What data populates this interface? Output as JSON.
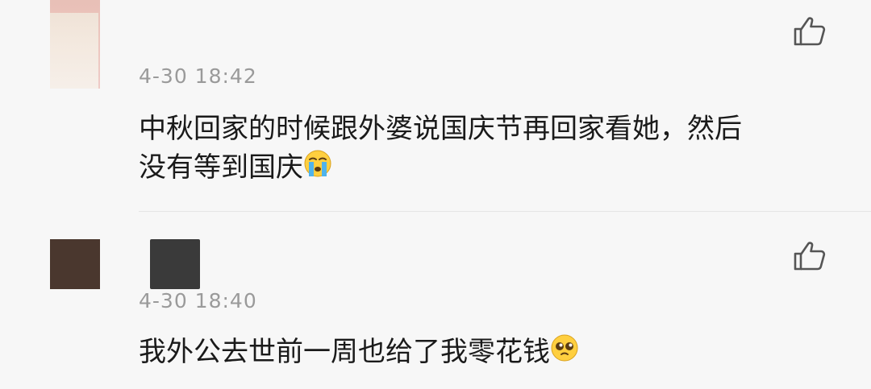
{
  "comments": [
    {
      "timestamp": "4-30 18:42",
      "text_line_1": "中秋回家的时候跟外婆说国庆节再回家看她，然后",
      "text_line_2": "没有等到国庆",
      "emoji": "crying-face",
      "like_icon": "thumbs-up-outline"
    },
    {
      "timestamp": "4-30 18:40",
      "text_line_1": "我外公去世前一周也给了我零花钱",
      "emoji": "pleading-face",
      "like_icon": "thumbs-up-outline"
    }
  ],
  "colors": {
    "background": "#f7f7f7",
    "text": "#1a1a1a",
    "timestamp": "#9a9a9a",
    "divider": "#e6e6e6",
    "icon": "#555555"
  }
}
